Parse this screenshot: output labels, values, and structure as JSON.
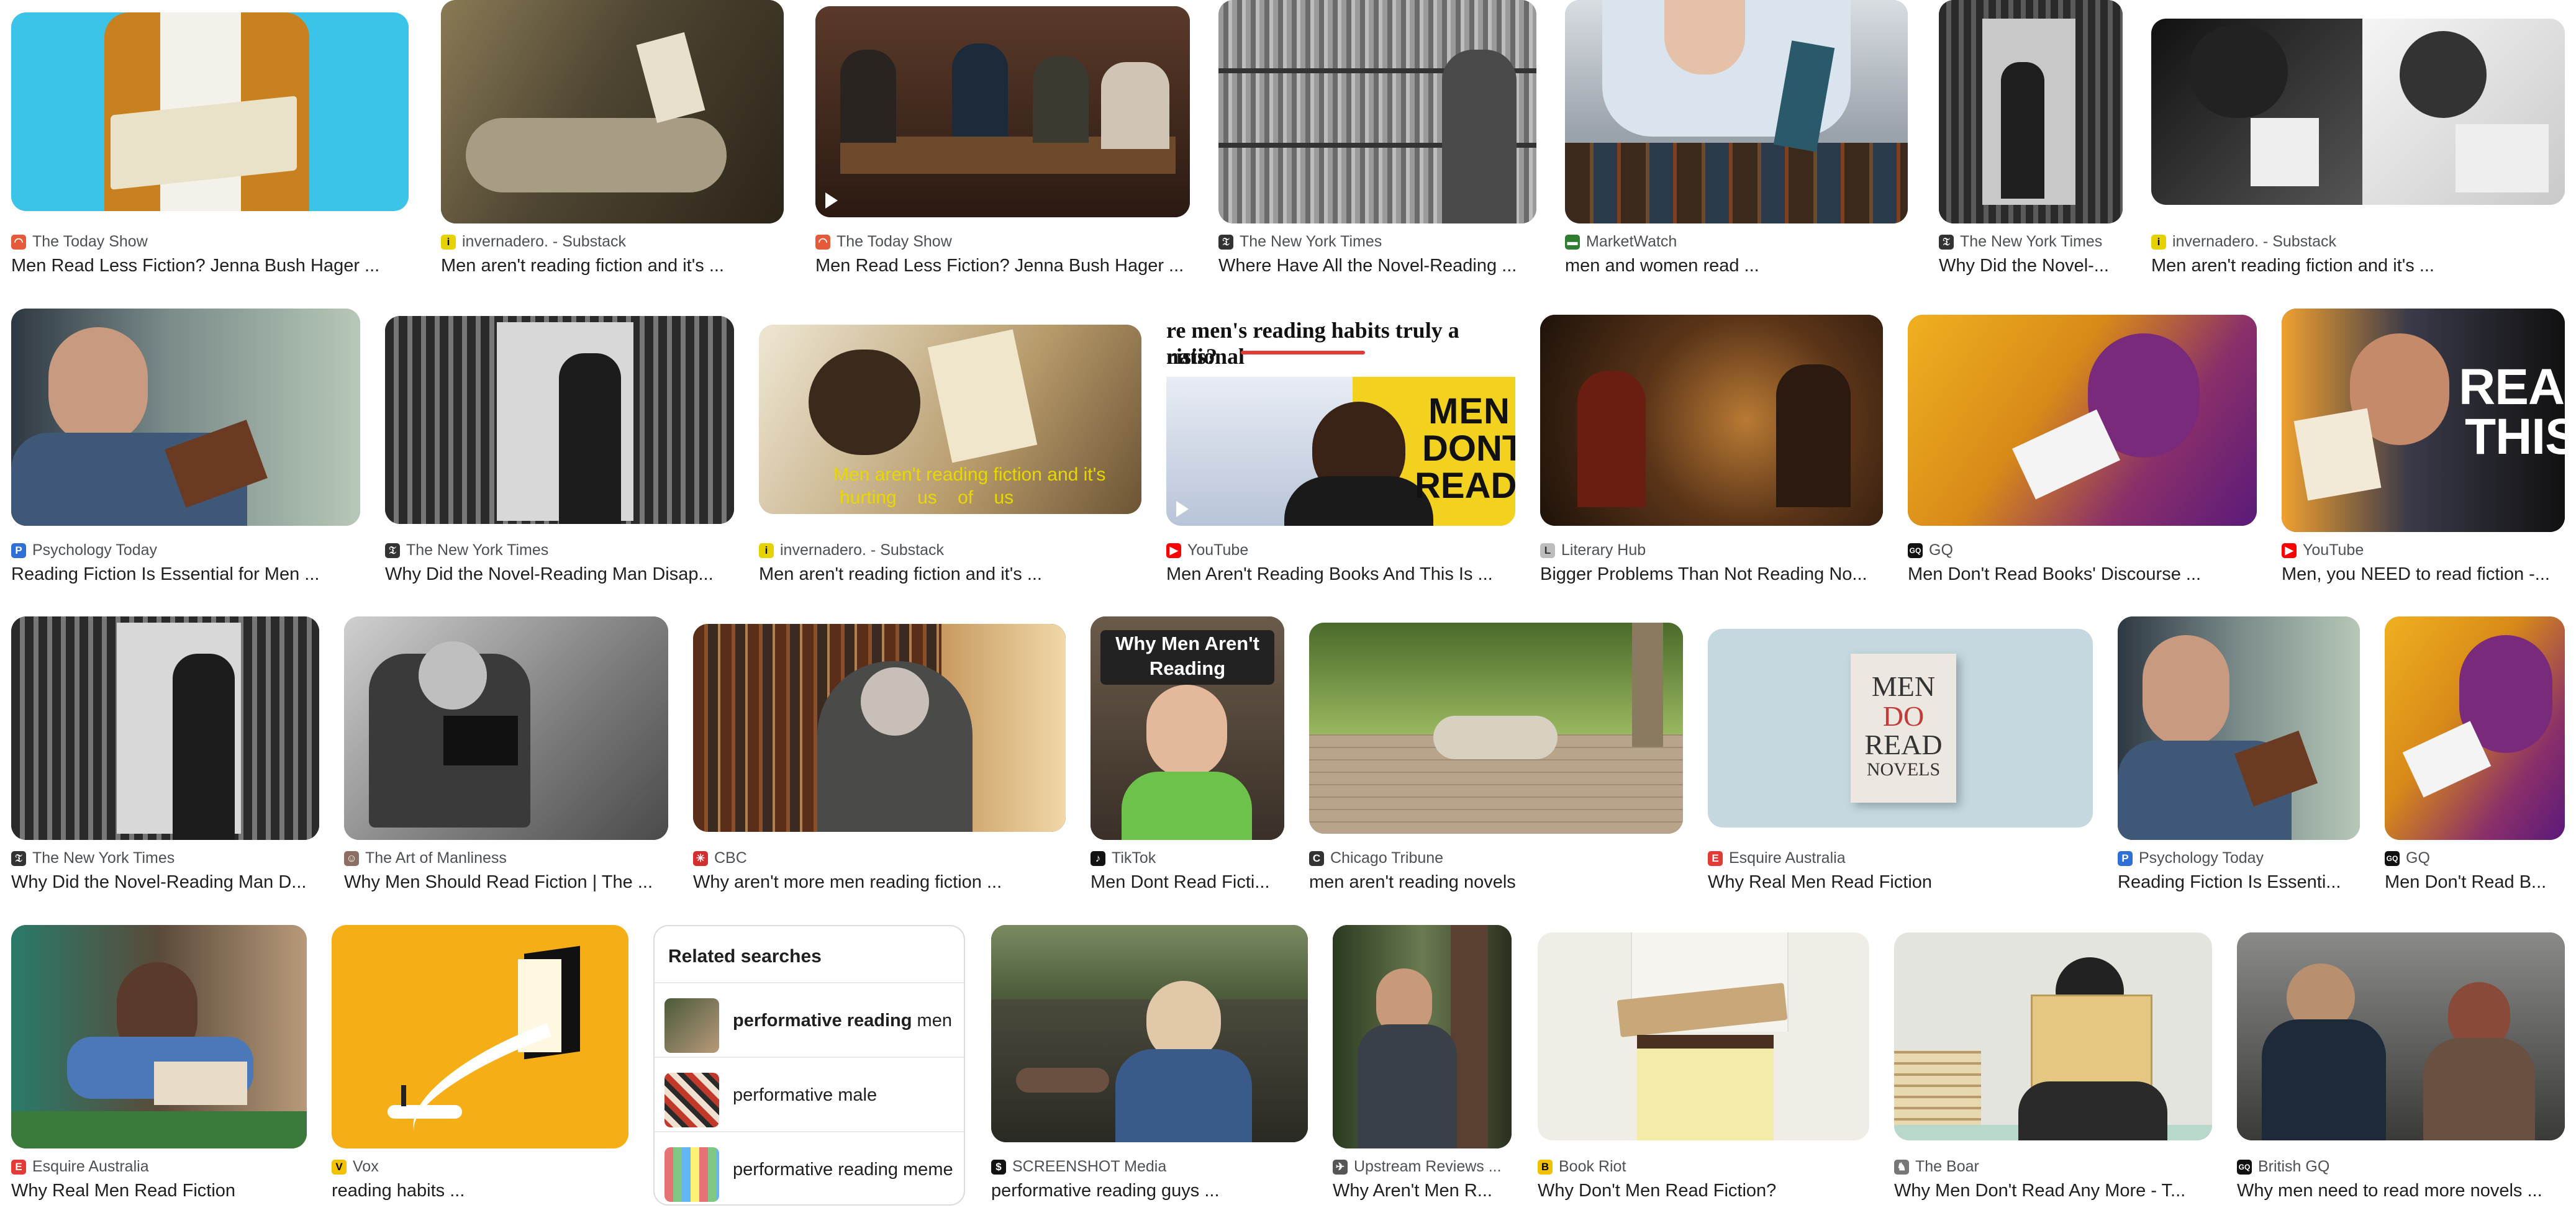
{
  "rows": [
    [
      {
        "source": "The Today Show",
        "title": "Men Read Less Fiction? Jenna Bush Hager ...",
        "favicon": "today-show-icon",
        "fav_color": "#e55a3b"
      },
      {
        "source": "invernadero. - Substack",
        "title": "Men aren't reading fiction and it's ...",
        "favicon": "substack-icon",
        "fav_color": "#e6d200"
      },
      {
        "source": "The Today Show",
        "title": "Men Read Less Fiction? Jenna Bush Hager ...",
        "favicon": "today-show-icon",
        "fav_color": "#e55a3b"
      },
      {
        "source": "The New York Times",
        "title": "Where Have All the Novel-Reading ...",
        "favicon": "nyt-icon",
        "fav_color": "#333333"
      },
      {
        "source": "MarketWatch",
        "title": "men and women read ...",
        "favicon": "marketwatch-icon",
        "fav_color": "#2e7d32"
      },
      {
        "source": "The New York Times",
        "title": "Why Did the Novel-...",
        "favicon": "nyt-icon",
        "fav_color": "#333333"
      },
      {
        "source": "invernadero. - Substack",
        "title": "Men aren't reading fiction and it's ...",
        "favicon": "substack-icon",
        "fav_color": "#e6d200"
      }
    ],
    [
      {
        "source": "Psychology Today",
        "title": "Reading Fiction Is Essential for Men ...",
        "favicon": "psychology-today-icon",
        "fav_color": "#2f6fd6"
      },
      {
        "source": "The New York Times",
        "title": "Why Did the Novel-Reading Man Disap...",
        "favicon": "nyt-icon",
        "fav_color": "#333333"
      },
      {
        "source": "invernadero. - Substack",
        "title": "Men aren't reading fiction and it's ...",
        "favicon": "substack-icon",
        "fav_color": "#e6d200"
      },
      {
        "source": "YouTube",
        "title": "Men Aren't Reading Books And This Is ...",
        "favicon": "youtube-icon",
        "fav_color": "#ff0000"
      },
      {
        "source": "Literary Hub",
        "title": "Bigger Problems Than Not Reading No...",
        "favicon": "literary-hub-icon",
        "fav_color": "#bdbdbd"
      },
      {
        "source": "GQ",
        "title": "Men Don't Read Books' Discourse ...",
        "favicon": "gq-icon",
        "fav_color": "#111111"
      },
      {
        "source": "YouTube",
        "title": "Men, you NEED to read fiction -...",
        "favicon": "youtube-icon",
        "fav_color": "#ff0000"
      }
    ],
    [
      {
        "source": "The New York Times",
        "title": "Why Did the Novel-Reading Man D...",
        "favicon": "nyt-icon",
        "fav_color": "#333333"
      },
      {
        "source": "The Art of Manliness",
        "title": "Why Men Should Read Fiction | The ...",
        "favicon": "art-of-manliness-icon",
        "fav_color": "#8d6e63"
      },
      {
        "source": "CBC",
        "title": "Why aren't more men reading fiction ...",
        "favicon": "cbc-icon",
        "fav_color": "#d32f2f"
      },
      {
        "source": "TikTok",
        "title": "Men Dont Read Ficti...",
        "favicon": "tiktok-icon",
        "fav_color": "#111111"
      },
      {
        "source": "Chicago Tribune",
        "title": "men aren't reading novels",
        "favicon": "chicago-tribune-icon",
        "fav_color": "#333333"
      },
      {
        "source": "Esquire Australia",
        "title": "Why Real Men Read Fiction",
        "favicon": "esquire-icon",
        "fav_color": "#e53935"
      },
      {
        "source": "Psychology Today",
        "title": "Reading Fiction Is Essenti...",
        "favicon": "psychology-today-icon",
        "fav_color": "#2f6fd6"
      },
      {
        "source": "GQ",
        "title": "Men Don't Read B...",
        "favicon": "gq-icon",
        "fav_color": "#111111"
      }
    ],
    [
      {
        "source": "Esquire Australia",
        "title": "Why Real Men Read Fiction",
        "favicon": "esquire-icon",
        "fav_color": "#e53935"
      },
      {
        "source": "Vox",
        "title": "reading habits ...",
        "favicon": "vox-icon",
        "fav_color": "#f2c200"
      },
      {
        "source": "SCREENSHOT Media",
        "title": "performative reading guys ...",
        "favicon": "screenshot-media-icon",
        "fav_color": "#111111"
      },
      {
        "source": "Upstream Reviews ...",
        "title": "Why Aren't Men R...",
        "favicon": "upstream-reviews-icon",
        "fav_color": "#555555"
      },
      {
        "source": "Book Riot",
        "title": "Why Don't Men Read Fiction?",
        "favicon": "book-riot-icon",
        "fav_color": "#f2c200"
      },
      {
        "source": "The Boar",
        "title": "Why Men Don't Read Any More - T...",
        "favicon": "the-boar-icon",
        "fav_color": "#777777"
      },
      {
        "source": "British GQ",
        "title": "Why men need to read more novels ...",
        "favicon": "british-gq-icon",
        "fav_color": "#111111"
      }
    ]
  ],
  "overlays": {
    "yt_headline": "re men's reading habits truly a national",
    "yt_headline2": "risis?",
    "yt_men": "MEN",
    "yt_dont": "DONT",
    "yt_read": "READ?",
    "read_this_1": "READ",
    "read_this_2": "THIS",
    "tiktok_caption_1": "Why Men Aren't",
    "tiktok_caption_2": "Reading",
    "book_men": "MEN",
    "book_do": "DO",
    "book_read": "READ",
    "book_novels": "NOVELS"
  },
  "related": {
    "title": "Related searches",
    "items": [
      {
        "bold": "performative reading",
        "rest": " men"
      },
      {
        "bold": "",
        "rest": "performative male"
      },
      {
        "bold": "",
        "rest": "performative reading meme"
      }
    ]
  }
}
